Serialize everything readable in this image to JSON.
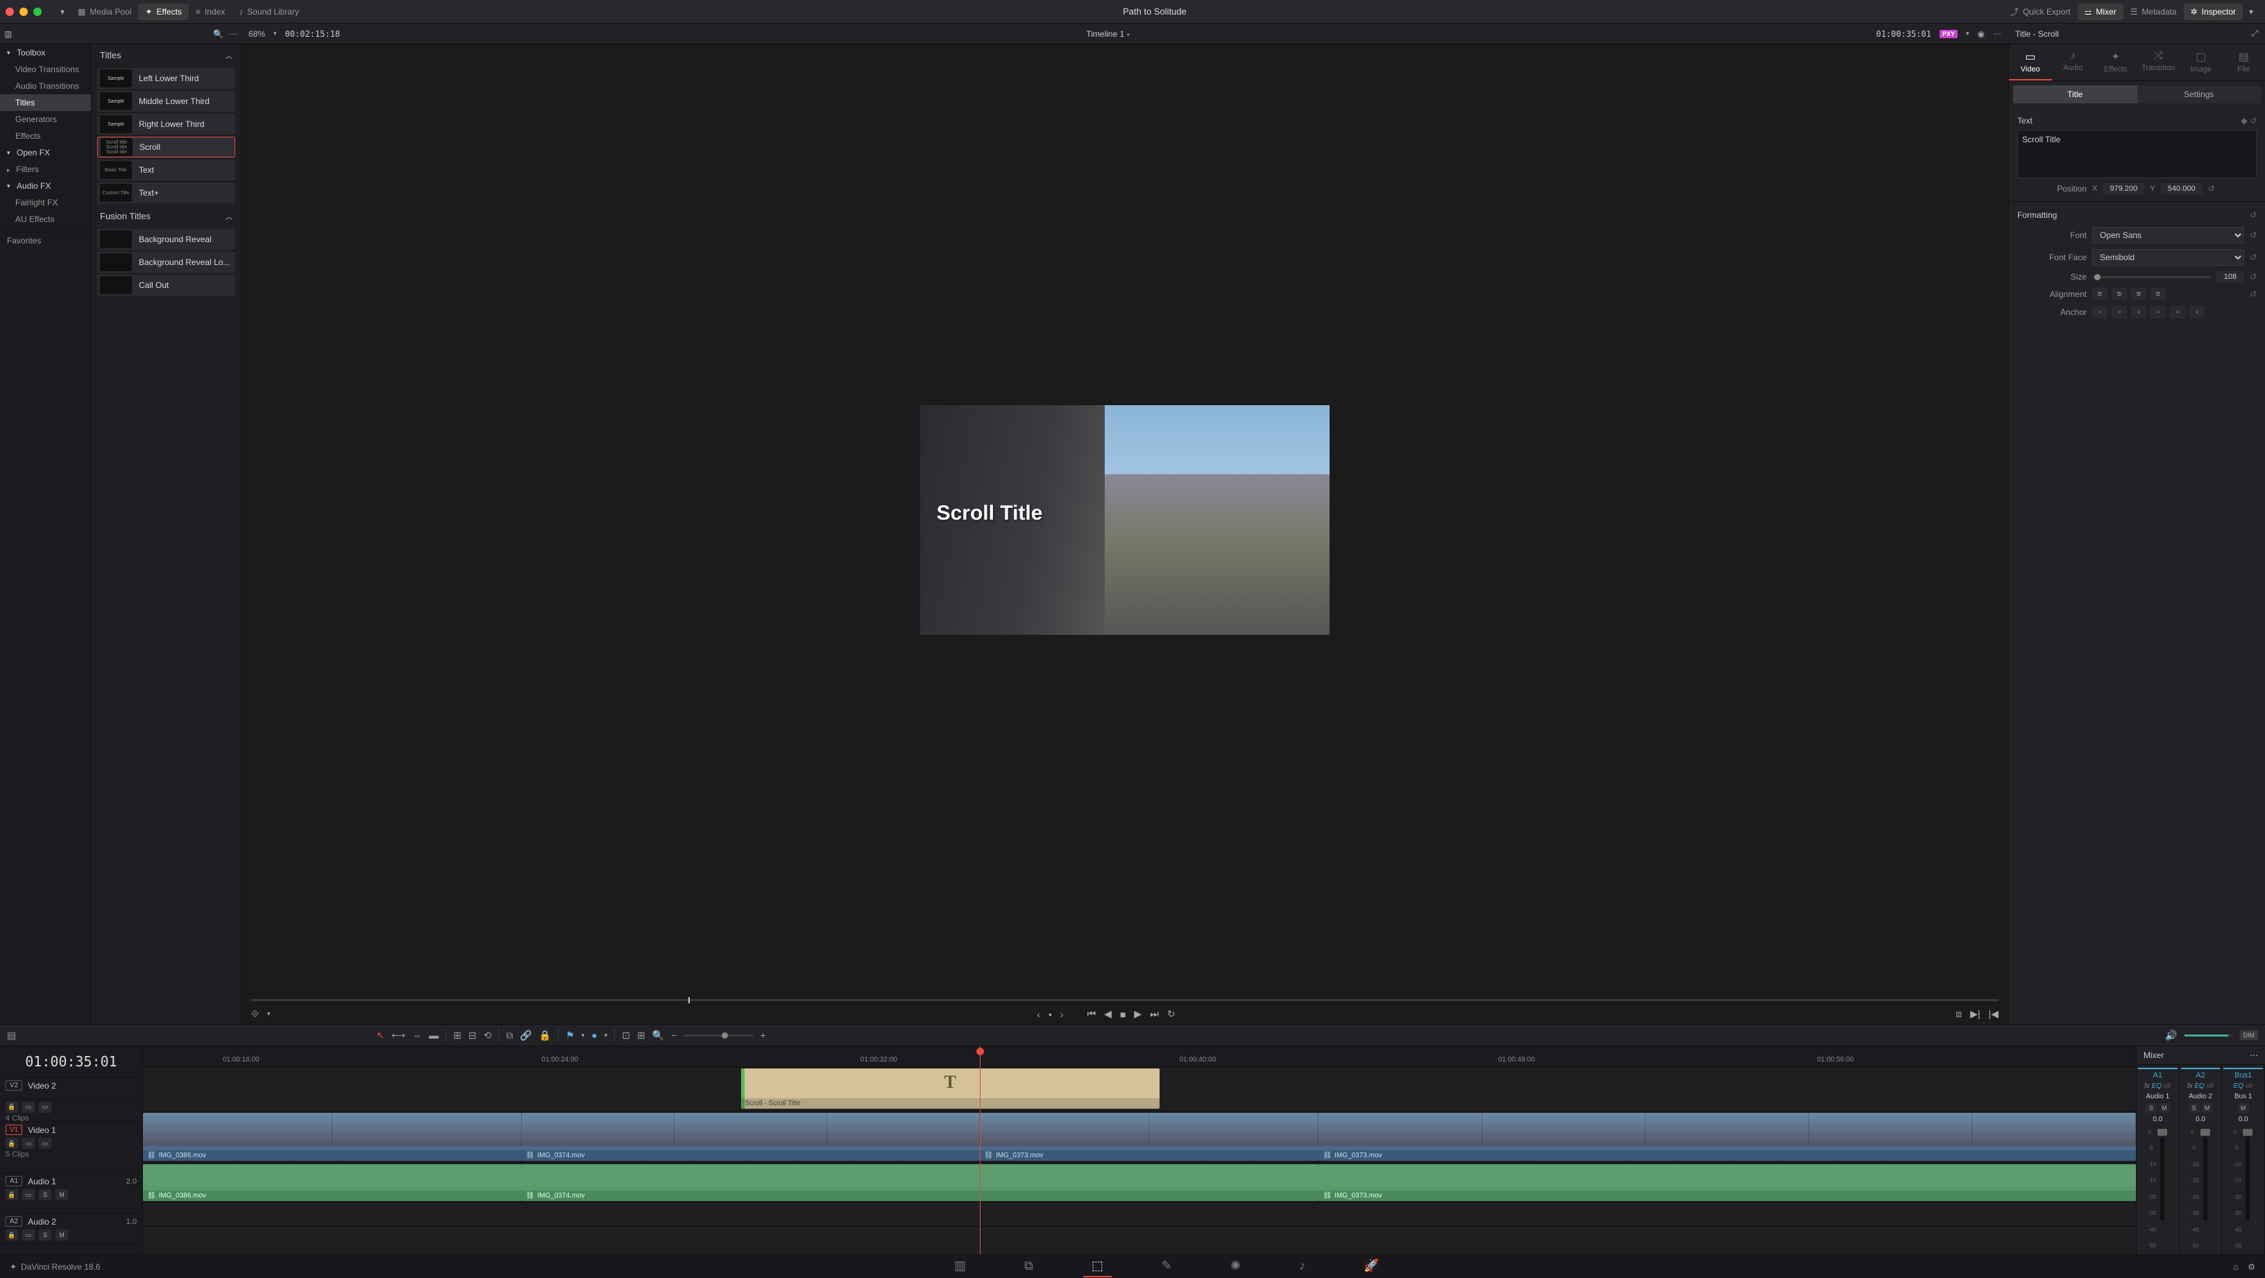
{
  "app": {
    "title": "Path to Solitude",
    "version": "DaVinci Resolve 18.6"
  },
  "topbar": {
    "media_pool": "Media Pool",
    "effects": "Effects",
    "index": "Index",
    "sound_library": "Sound Library",
    "quick_export": "Quick Export",
    "mixer": "Mixer",
    "metadata": "Metadata",
    "inspector": "Inspector"
  },
  "subheader": {
    "zoom_pct": "68%",
    "source_tc": "00:02:15:18",
    "timeline_name": "Timeline 1",
    "record_tc": "01:00:35:01",
    "proxy": "PXY",
    "inspector_title": "Title - Scroll"
  },
  "left_tree": {
    "toolbox": "Toolbox",
    "video_transitions": "Video Transitions",
    "audio_transitions": "Audio Transitions",
    "titles": "Titles",
    "generators": "Generators",
    "effects": "Effects",
    "open_fx": "Open FX",
    "filters": "Filters",
    "audio_fx": "Audio FX",
    "fairlight_fx": "Fairlight FX",
    "au_effects": "AU Effects",
    "favorites": "Favorites"
  },
  "titles_list": {
    "header": "Titles",
    "items": [
      {
        "thumb": "Sample",
        "label": "Left Lower Third"
      },
      {
        "thumb": "Sample",
        "label": "Middle Lower Third"
      },
      {
        "thumb": "Sample",
        "label": "Right Lower Third"
      },
      {
        "thumb": "Scroll title",
        "label": "Scroll",
        "selected": true
      },
      {
        "thumb": "Basic Title",
        "label": "Text"
      },
      {
        "thumb": "Custom Title",
        "label": "Text+"
      }
    ],
    "fusion_header": "Fusion Titles",
    "fusion_items": [
      {
        "thumb": "",
        "label": "Background Reveal"
      },
      {
        "thumb": "",
        "label": "Background Reveal Lo..."
      },
      {
        "thumb": "",
        "label": "Call Out"
      }
    ]
  },
  "viewer": {
    "overlay_text": "Scroll Title"
  },
  "inspector": {
    "tabs": {
      "video": "Video",
      "audio": "Audio",
      "effects": "Effects",
      "transition": "Transition",
      "image": "Image",
      "file": "File"
    },
    "subtabs": {
      "title": "Title",
      "settings": "Settings"
    },
    "text_section": "Text",
    "text_value": "Scroll Title",
    "position_label": "Position",
    "pos_x": "979.200",
    "pos_y": "540.000",
    "formatting": "Formatting",
    "font_label": "Font",
    "font_value": "Open Sans",
    "face_label": "Font Face",
    "face_value": "Semibold",
    "size_label": "Size",
    "size_value": "108",
    "alignment_label": "Alignment",
    "anchor_label": "Anchor"
  },
  "timeline": {
    "big_tc": "01:00:35:01",
    "ruler": [
      "01:00:16:00",
      "01:00:24:00",
      "01:00:32:00",
      "01:00:40:00",
      "01:00:48:00",
      "01:00:56:00"
    ],
    "tracks": {
      "v2": {
        "badge": "V2",
        "name": "Video 2",
        "clips": "4 Clips"
      },
      "v1": {
        "badge": "V1",
        "name": "Video 1",
        "clips": "5 Clips"
      },
      "a1": {
        "badge": "A1",
        "name": "Audio 1",
        "level": "2.0"
      },
      "a2": {
        "badge": "A2",
        "name": "Audio 2",
        "level": "1.0"
      }
    },
    "title_clip": "Scroll - Scroll Title",
    "video_clips": [
      "IMG_0386.mov",
      "IMG_0374.mov",
      "IMG_0373.mov",
      "IMG_0373.mov"
    ],
    "audio_clips": [
      "IMG_0386.mov",
      "IMG_0374.mov",
      "IMG_0373.mov"
    ]
  },
  "mixer": {
    "header": "Mixer",
    "strips": [
      {
        "ch": "A1",
        "name": "Audio 1",
        "db": "0.0"
      },
      {
        "ch": "A2",
        "name": "Audio 2",
        "db": "0.0"
      },
      {
        "ch": "Bus1",
        "name": "Bus 1",
        "db": "0.0"
      }
    ],
    "eq": "EQ",
    "scale": [
      "0",
      "-5",
      "-10",
      "-15",
      "-20",
      "-30",
      "-40",
      "-50"
    ]
  }
}
